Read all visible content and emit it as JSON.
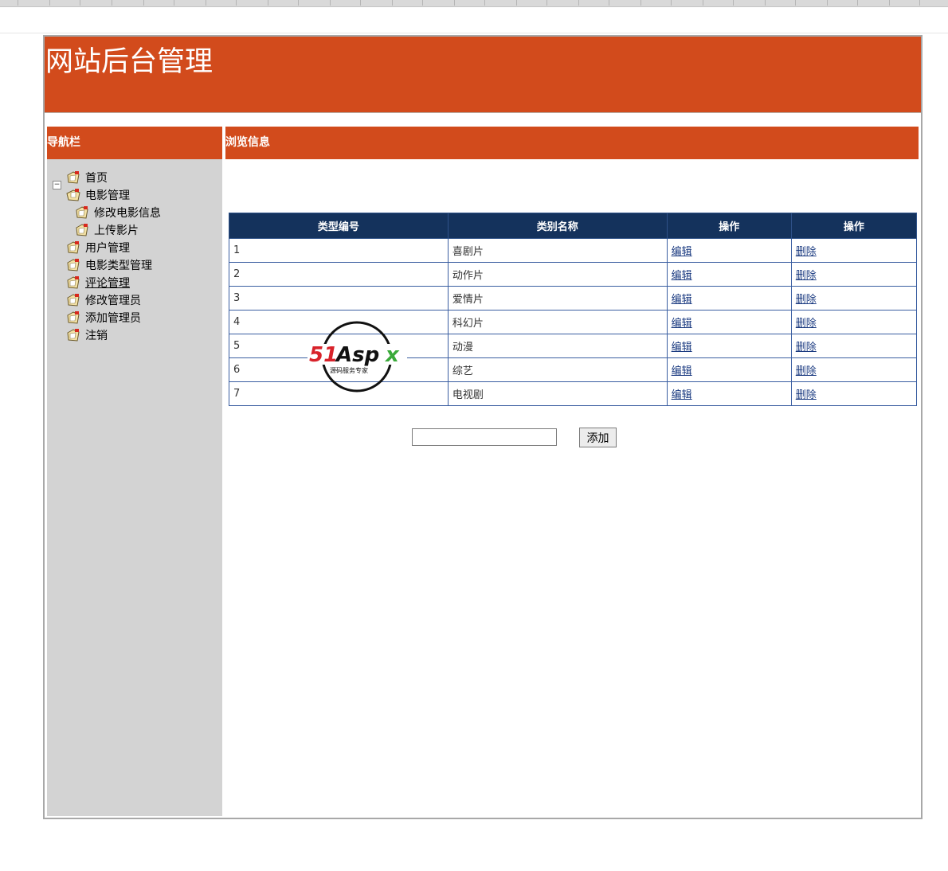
{
  "header": {
    "title": "网站后台管理"
  },
  "sidebar": {
    "heading": "导航栏",
    "items": [
      {
        "label": "首页"
      },
      {
        "label": "电影管理"
      },
      {
        "label": "修改电影信息"
      },
      {
        "label": "上传影片"
      },
      {
        "label": "用户管理"
      },
      {
        "label": "电影类型管理"
      },
      {
        "label": "评论管理"
      },
      {
        "label": "修改管理员"
      },
      {
        "label": "添加管理员"
      },
      {
        "label": "注销"
      }
    ],
    "expander_symbol": "−"
  },
  "main": {
    "heading": "浏览信息",
    "table": {
      "columns": [
        "类型编号",
        "类别名称",
        "操作",
        "操作"
      ],
      "rows": [
        {
          "id": "1",
          "name": "喜剧片",
          "edit": "编辑",
          "delete": "删除"
        },
        {
          "id": "2",
          "name": "动作片",
          "edit": "编辑",
          "delete": "删除"
        },
        {
          "id": "3",
          "name": "爱情片",
          "edit": "编辑",
          "delete": "删除"
        },
        {
          "id": "4",
          "name": "科幻片",
          "edit": "编辑",
          "delete": "删除"
        },
        {
          "id": "5",
          "name": "动漫",
          "edit": "编辑",
          "delete": "删除"
        },
        {
          "id": "6",
          "name": "综艺",
          "edit": "编辑",
          "delete": "删除"
        },
        {
          "id": "7",
          "name": "电视剧",
          "edit": "编辑",
          "delete": "删除"
        }
      ]
    },
    "add_form": {
      "input_value": "",
      "button_label": "添加"
    }
  },
  "watermark": {
    "brand": "51Aspx",
    "tagline": "源码服务专家"
  },
  "colors": {
    "accent": "#d24b1c",
    "table_header": "#14325c",
    "sidebar_bg": "#d3d3d3"
  }
}
